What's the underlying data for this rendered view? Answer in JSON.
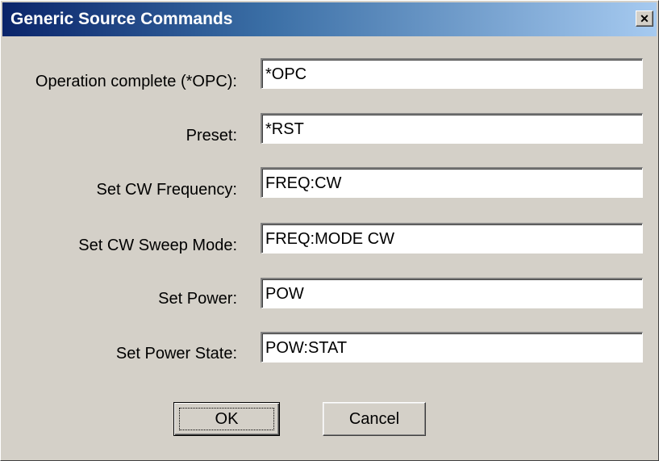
{
  "window": {
    "title": "Generic Source Commands",
    "close_glyph": "✕"
  },
  "fields": [
    {
      "label": "Operation complete (*OPC):",
      "value": "*OPC"
    },
    {
      "label": "Preset:",
      "value": "*RST"
    },
    {
      "label": "Set CW Frequency:",
      "value": "FREQ:CW"
    },
    {
      "label": "Set CW Sweep Mode:",
      "value": "FREQ:MODE CW"
    },
    {
      "label": "Set Power:",
      "value": "POW"
    },
    {
      "label": "Set Power State:",
      "value": "POW:STAT"
    }
  ],
  "buttons": {
    "ok_label": "OK",
    "cancel_label": "Cancel"
  }
}
